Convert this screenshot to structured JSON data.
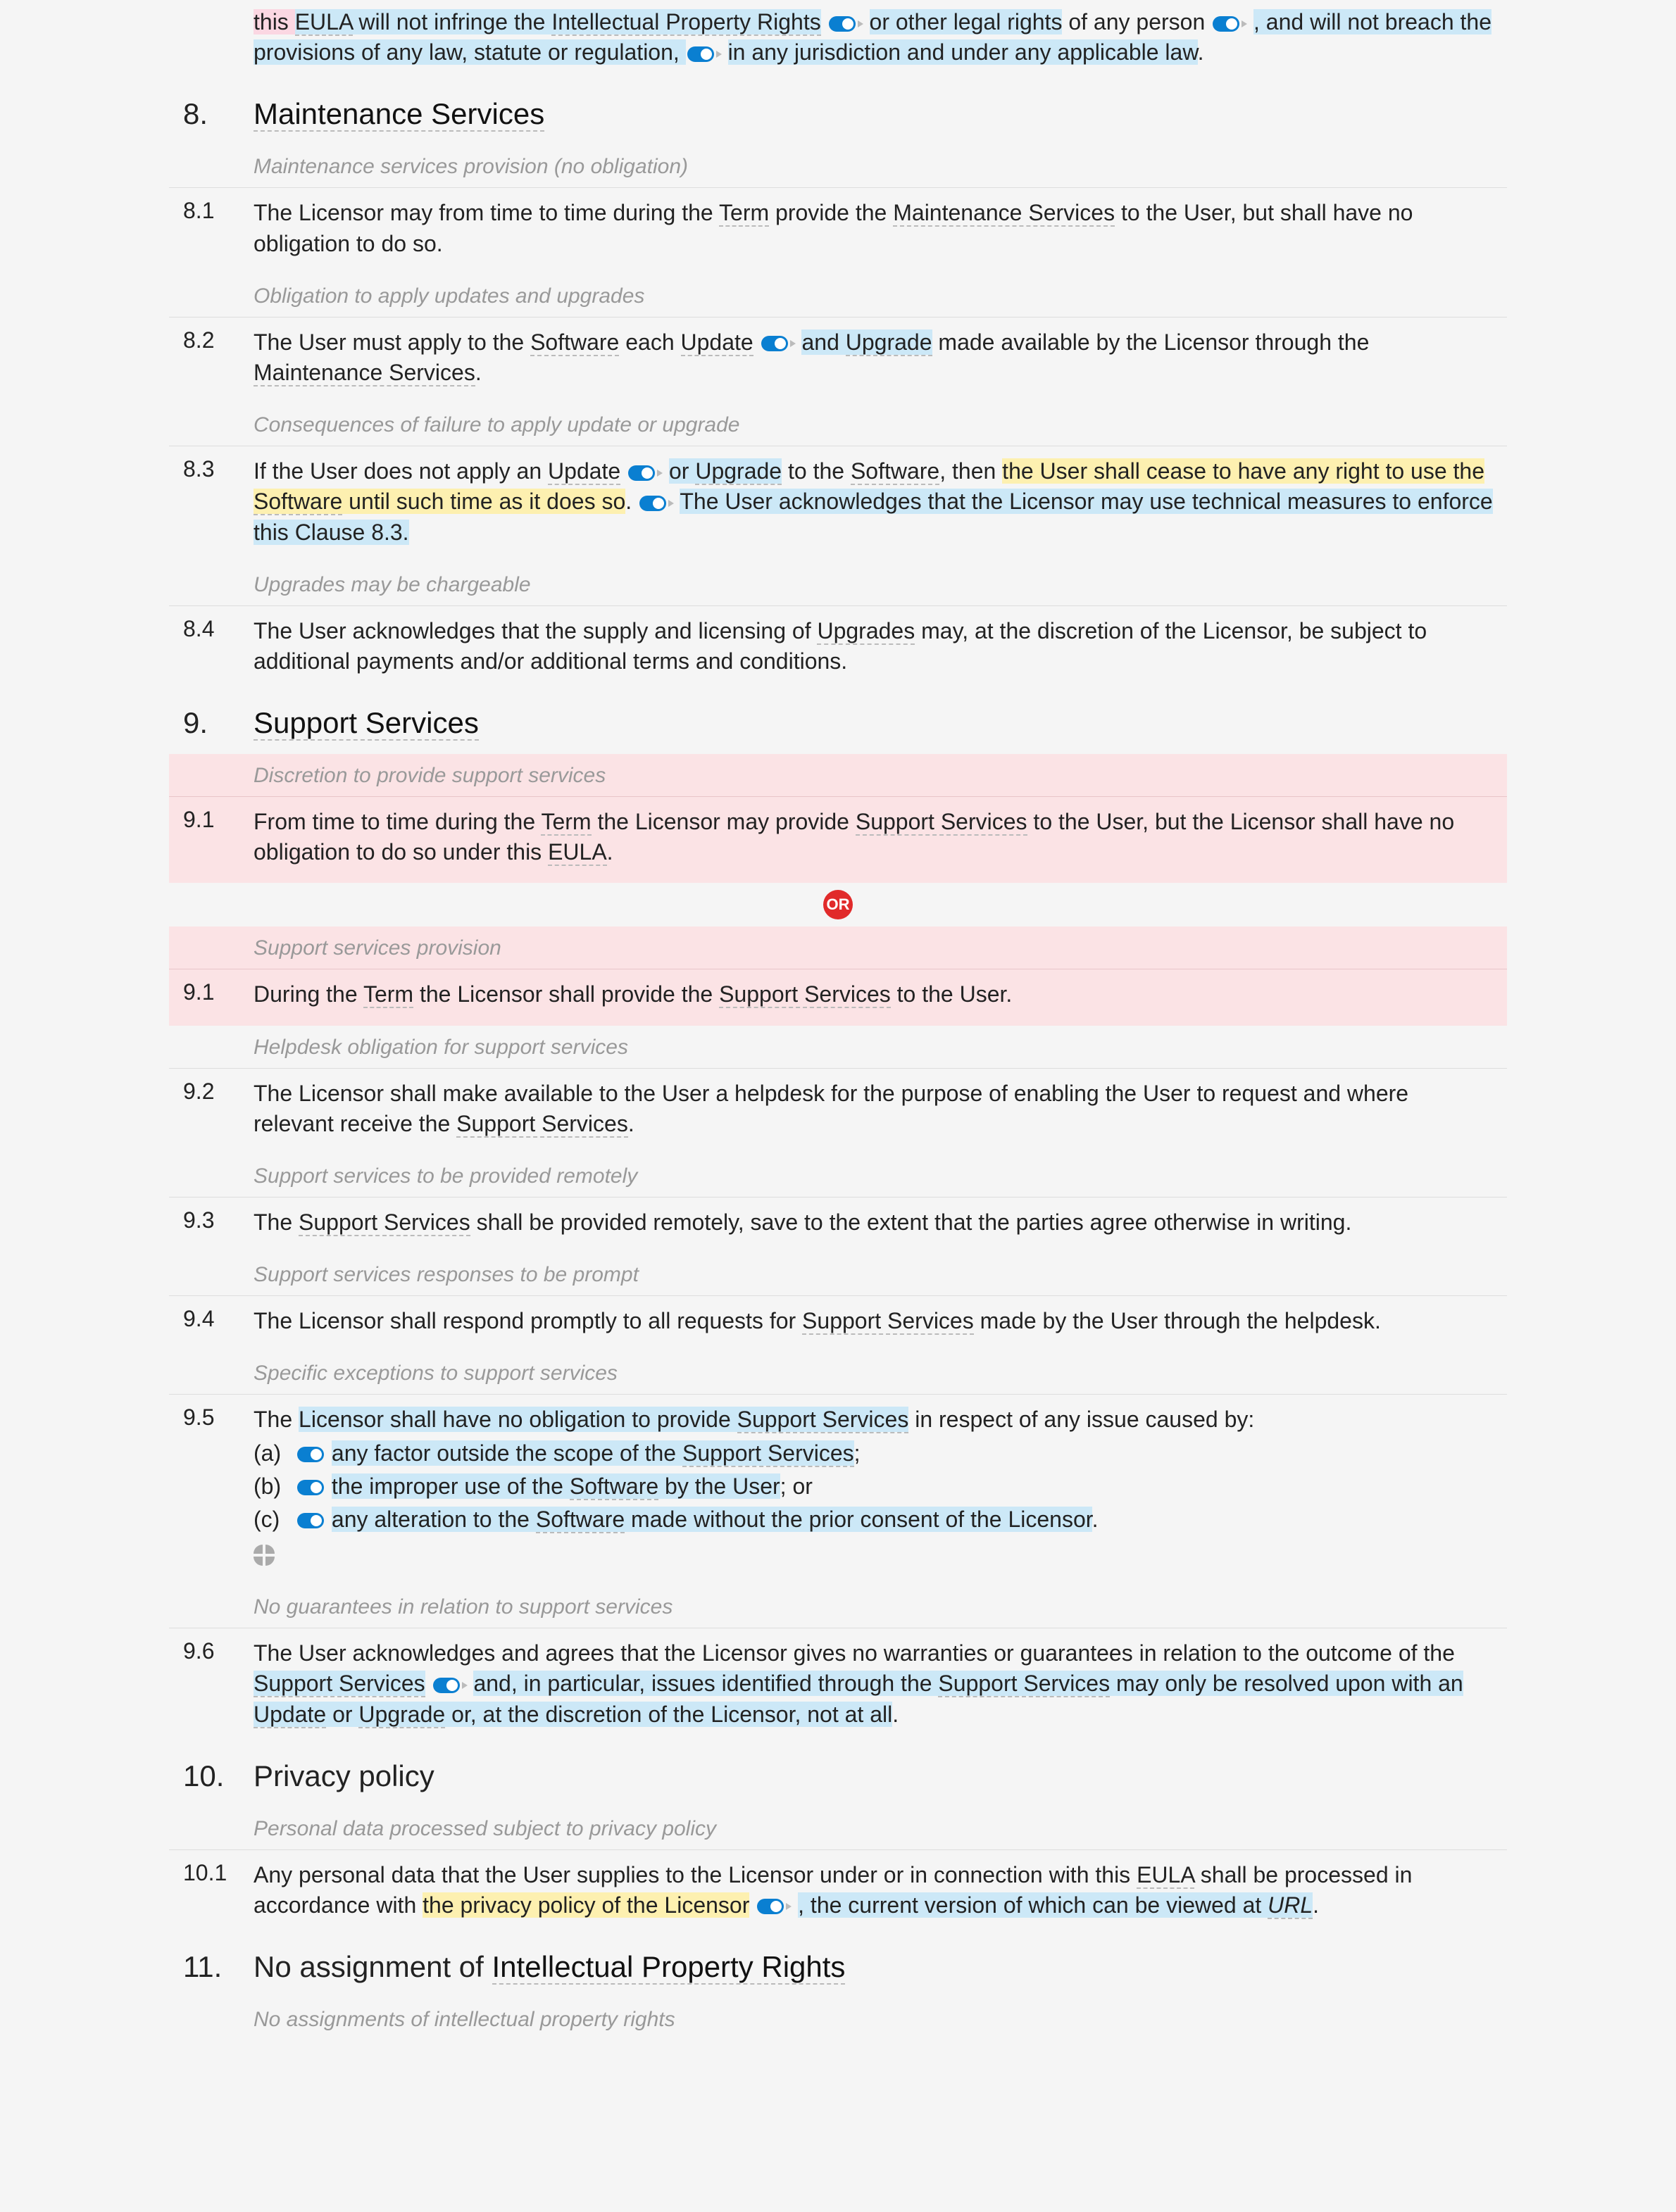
{
  "top_fragment": {
    "t1a": "this ",
    "t1b": "EULA",
    "t2": " will not infringe the ",
    "t3": "Intellectual Property Rights",
    "t4": " or other legal rights",
    "t5": " of any person ",
    "t6": ", and will not breach the provisions of any law, statute or regulation, ",
    "t7": "in any jurisdiction and under any applicable law",
    "t8": "."
  },
  "s8": {
    "num": "8.",
    "title": "Maintenance Services",
    "h1": "Maintenance services provision (no obligation)",
    "c1_num": "8.1",
    "c1_a": "The Licensor may from time to time during the ",
    "c1_b": "Term",
    "c1_c": " provide the ",
    "c1_d": "Maintenance Services",
    "c1_e": " to the User, but shall have no obligation to do so.",
    "h2": "Obligation to apply updates and upgrades",
    "c2_num": "8.2",
    "c2_a": "The User must apply to the ",
    "c2_b": "Software",
    "c2_c": " each ",
    "c2_d": "Update",
    "c2_e": "and ",
    "c2_f": "Upgrade",
    "c2_g": " made available by the Licensor through the ",
    "c2_h": "Maintenance Services",
    "c2_i": ".",
    "h3": "Consequences of failure to apply update or upgrade",
    "c3_num": "8.3",
    "c3_a": "If the User does not apply an ",
    "c3_b": "Update",
    "c3_c": "or ",
    "c3_d": "Upgrade",
    "c3_e": " to the ",
    "c3_f": "Software",
    "c3_g": ", then ",
    "c3_h": "the User shall cease to have any right to use the ",
    "c3_i": "Software",
    "c3_j": " until such time as it does so",
    "c3_k": ". ",
    "c3_l": "The User acknowledges that the Licensor may use technical measures to enforce this Clause 8.3.",
    "h4": "Upgrades may be chargeable",
    "c4_num": "8.4",
    "c4_a": "The User acknowledges that the supply and licensing of ",
    "c4_b": "Upgrades",
    "c4_c": " may, at the discretion of the Licensor, be subject to additional payments and/or additional terms and conditions."
  },
  "s9": {
    "num": "9.",
    "title": "Support Services",
    "alt1_h": "Discretion to provide support services",
    "alt1_num": "9.1",
    "alt1_a": "From time to time during the ",
    "alt1_b": "Term",
    "alt1_c": " the Licensor may provide ",
    "alt1_d": "Support Services",
    "alt1_e": " to the User, but the Licensor shall have no obligation to do so under this ",
    "alt1_f": "EULA",
    "alt1_g": ".",
    "or": "OR",
    "alt2_h": "Support services provision",
    "alt2_num": "9.1",
    "alt2_a": "During the ",
    "alt2_b": "Term",
    "alt2_c": " the Licensor shall provide the ",
    "alt2_d": "Support Services",
    "alt2_e": " to the User.",
    "h2": "Helpdesk obligation for support services",
    "c2_num": "9.2",
    "c2_a": "The Licensor shall make available to the User a helpdesk for the purpose of enabling the User to request and where relevant receive the ",
    "c2_b": "Support Services",
    "c2_c": ".",
    "h3": "Support services to be provided remotely",
    "c3_num": "9.3",
    "c3_a": "The ",
    "c3_b": "Support Services",
    "c3_c": " shall be provided remotely, save to the extent that the parties agree otherwise in writing.",
    "h4": "Support services responses to be prompt",
    "c4_num": "9.4",
    "c4_a": "The Licensor shall respond promptly to all requests for ",
    "c4_b": "Support Services",
    "c4_c": " made by the User through the helpdesk.",
    "h5": "Specific exceptions to support services",
    "c5_num": "9.5",
    "c5_a": "The ",
    "c5_b": "Licensor shall have no obligation to provide ",
    "c5_c": "Support Services",
    "c5_d": " in respect of any issue caused by:",
    "c5_la": "(a)",
    "c5_lat1": "any factor outside the scope of the ",
    "c5_lat2": "Support Services",
    "c5_lat3": ";",
    "c5_lb": "(b)",
    "c5_lbt1": "the improper use of the ",
    "c5_lbt2": "Software",
    "c5_lbt3": " by the User",
    "c5_lbt4": "; or",
    "c5_lc": "(c)",
    "c5_lct1": "any alteration to the ",
    "c5_lct2": "Software",
    "c5_lct3": " made without the prior consent of the Licensor",
    "c5_lct4": ".",
    "h6": "No guarantees in relation to support services",
    "c6_num": "9.6",
    "c6_a": "The User acknowledges and agrees that the Licensor gives no warranties or guarantees in relation to the outcome of the ",
    "c6_b": "Support Services",
    "c6_c": " ",
    "c6_d": "and, in particular, issues identified through the ",
    "c6_e": "Support Services",
    "c6_f": " may only be resolved upon with an ",
    "c6_g": "Update",
    "c6_h": " or ",
    "c6_i": "Upgrade",
    "c6_j": " or, at the discretion of the Licensor, not at all",
    "c6_k": "."
  },
  "s10": {
    "num": "10.",
    "title": "Privacy policy",
    "h1": "Personal data processed subject to privacy policy",
    "c1_num": "10.1",
    "c1_a": "Any personal data that the User supplies to the Licensor under or in connection with this ",
    "c1_b": "EULA",
    "c1_c": " shall be processed in accordance with ",
    "c1_d": "the privacy policy of the Licensor",
    "c1_e": " ",
    "c1_f": ", the current version of which can be viewed at ",
    "c1_g": "URL",
    "c1_h": "."
  },
  "s11": {
    "num": "11.",
    "title": "No assignment of ",
    "title_def": "Intellectual Property Rights",
    "h1": "No assignments of intellectual property rights"
  }
}
